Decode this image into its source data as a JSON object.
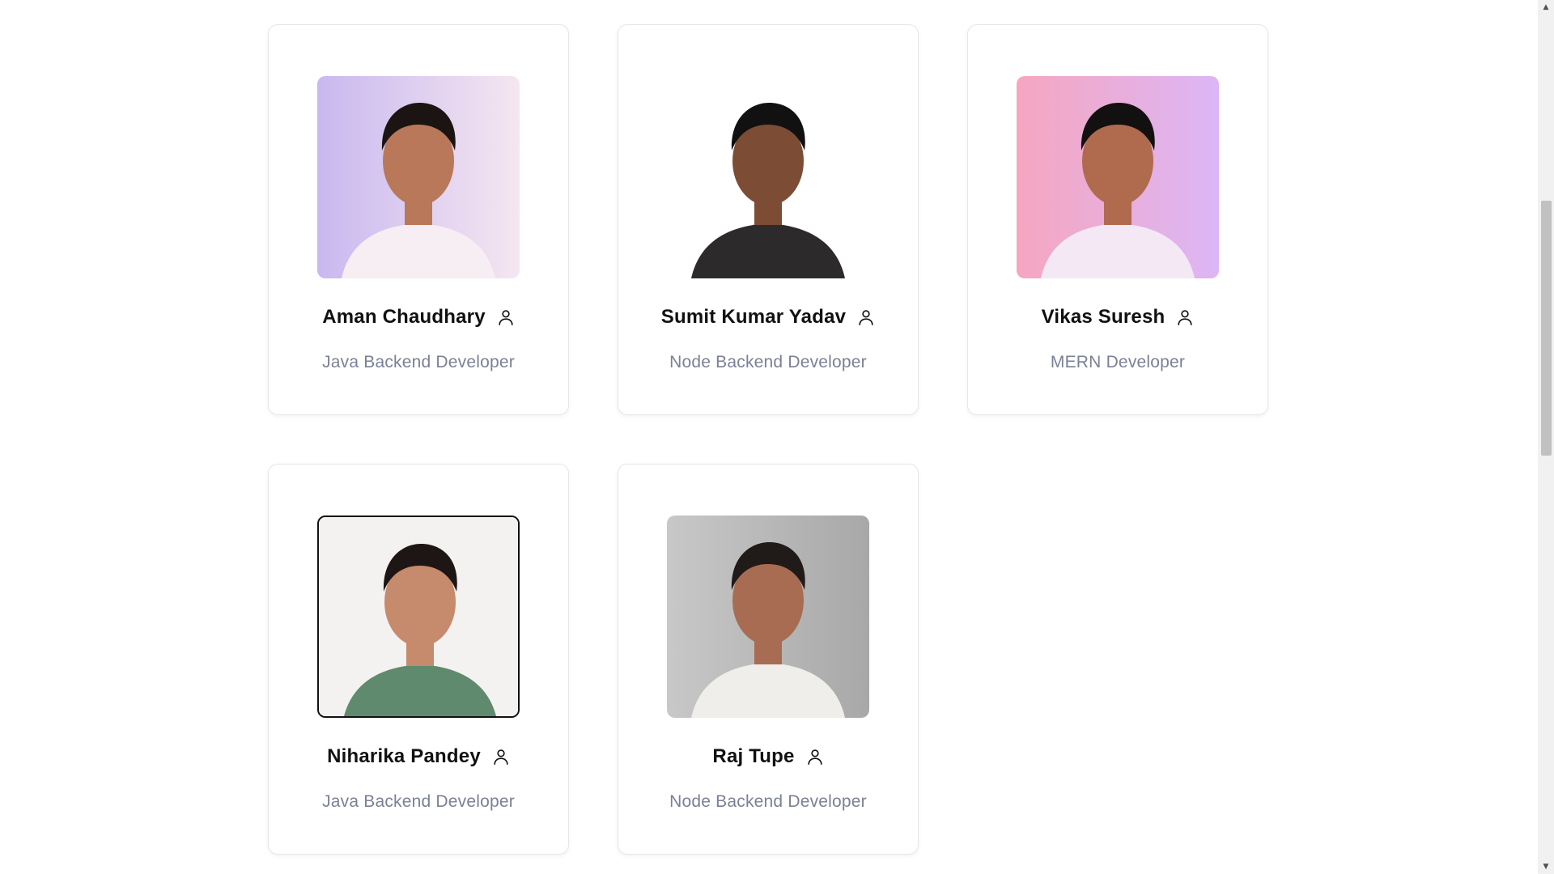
{
  "team": [
    {
      "name": "Aman Chaudhary",
      "role": "Java Backend Developer",
      "photo_bg": [
        "#c9b8f0",
        "#f5e6f0"
      ],
      "shirt": "#f6eef2",
      "hair": "#1b1412",
      "skin": "#b9785a"
    },
    {
      "name": "Sumit Kumar Yadav",
      "role": "Node Backend Developer",
      "photo_bg": [
        "#ffffff",
        "#ffffff"
      ],
      "shirt": "#2d2a2b",
      "hair": "#111111",
      "skin": "#7c4c35"
    },
    {
      "name": "Vikas Suresh",
      "role": "MERN Developer",
      "photo_bg": [
        "#f6a6c0",
        "#dcb6f6"
      ],
      "shirt": "#f3e8f3",
      "hair": "#121010",
      "skin": "#b06a4e"
    },
    {
      "name": "Niharika Pandey",
      "role": "Java Backend Developer",
      "photo_bg": [
        "#f4f1f1",
        "#f4f1f1"
      ],
      "shirt": "#5f8a6e",
      "hair": "#1e1614",
      "skin": "#c68a6c"
    },
    {
      "name": "Raj Tupe",
      "role": "Node Backend Developer",
      "photo_bg": [
        "#c8c8c8",
        "#a8a8a8"
      ],
      "shirt": "#efeeea",
      "hair": "#201a18",
      "skin": "#a86c52"
    }
  ],
  "icons": {
    "profile": "user-icon"
  },
  "colors": {
    "role_text": "#7b8195",
    "name_text": "#111111",
    "card_border": "#e4e6ea"
  }
}
